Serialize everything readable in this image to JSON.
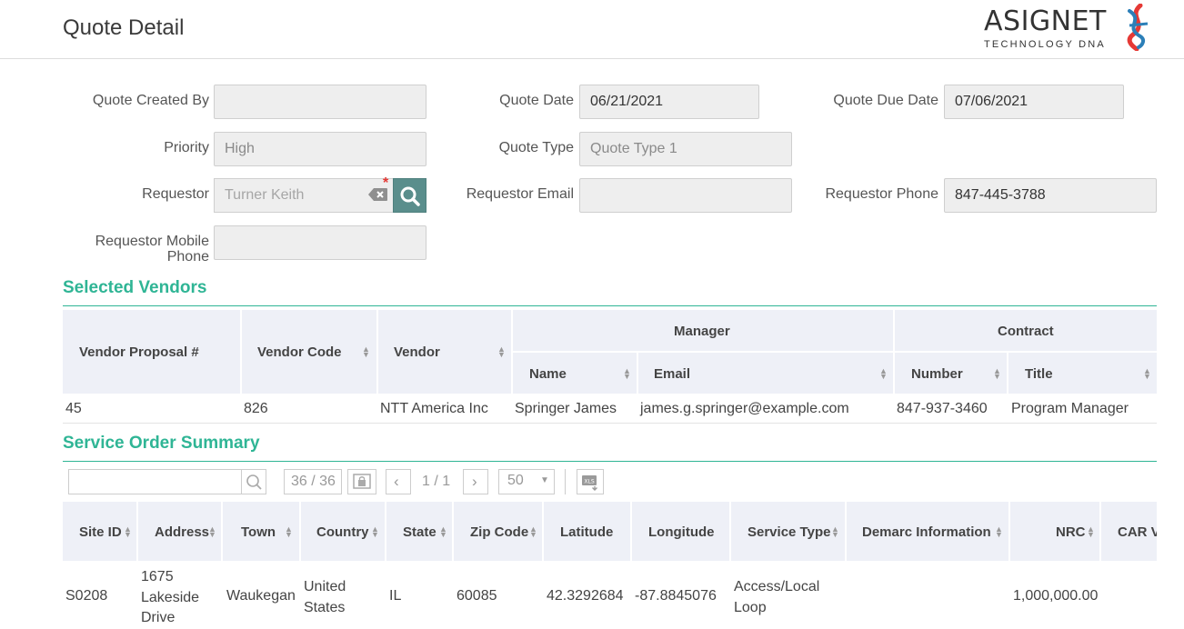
{
  "header": {
    "title": "Quote Detail"
  },
  "logo": {
    "name": "ASIGNET",
    "tagline": "TECHNOLOGY DNA"
  },
  "form": {
    "created_by_label": "Quote Created By",
    "created_by_value": "",
    "quote_date_label": "Quote Date",
    "quote_date_value": "06/21/2021",
    "due_date_label": "Quote Due Date",
    "due_date_value": "07/06/2021",
    "priority_label": "Priority",
    "priority_value": "High",
    "quote_type_label": "Quote Type",
    "quote_type_value": "Quote Type 1",
    "requestor_label": "Requestor",
    "requestor_value": "Turner Keith",
    "requestor_email_label": "Requestor Email",
    "requestor_email_value": "",
    "requestor_phone_label": "Requestor Phone",
    "requestor_phone_value": "847-445-3788",
    "mobile_label_line1": "Requestor Mobile",
    "mobile_label_line2": "Phone",
    "mobile_value": ""
  },
  "vendors": {
    "title": "Selected Vendors",
    "headers": {
      "proposal": "Vendor Proposal #",
      "code": "Vendor Code",
      "vendor": "Vendor",
      "manager": "Manager",
      "contract": "Contract",
      "name": "Name",
      "email": "Email",
      "number": "Number",
      "title": "Title"
    },
    "row": {
      "proposal": "45",
      "code": "826",
      "vendor": "NTT America Inc",
      "name": "Springer James",
      "email": "james.g.springer@example.com",
      "number": "847-937-3460",
      "title": "Program Manager"
    }
  },
  "orders": {
    "title": "Service Order Summary",
    "toolbar": {
      "search_value": "",
      "count": "36 / 36",
      "page": "1 / 1",
      "page_size": "50"
    },
    "headers": {
      "site_id": "Site ID",
      "address": "Address",
      "town": "Town",
      "country": "Country",
      "state": "State",
      "zip": "Zip Code",
      "lat": "Latitude",
      "lng": "Longitude",
      "service_type": "Service Type",
      "demarc": "Demarc Information",
      "nrc": "NRC",
      "car": "CAR Va"
    },
    "row": {
      "site_id": "S0208",
      "address_l1": "1675",
      "address_l2": "Lakeside",
      "address_l3": "Drive",
      "town": "Waukegan",
      "country_l1": "United",
      "country_l2": "States",
      "state": "IL",
      "zip": "60085",
      "lat": "42.3292684",
      "lng": "-87.8845076",
      "service_l1": "Access/Local",
      "service_l2": "Loop",
      "demarc": "",
      "nrc": "1,000,000.00",
      "car": ""
    }
  },
  "colors": {
    "accent": "#2fb595",
    "header_bg": "#eef0f7",
    "search_btn": "#5a8e8c"
  }
}
